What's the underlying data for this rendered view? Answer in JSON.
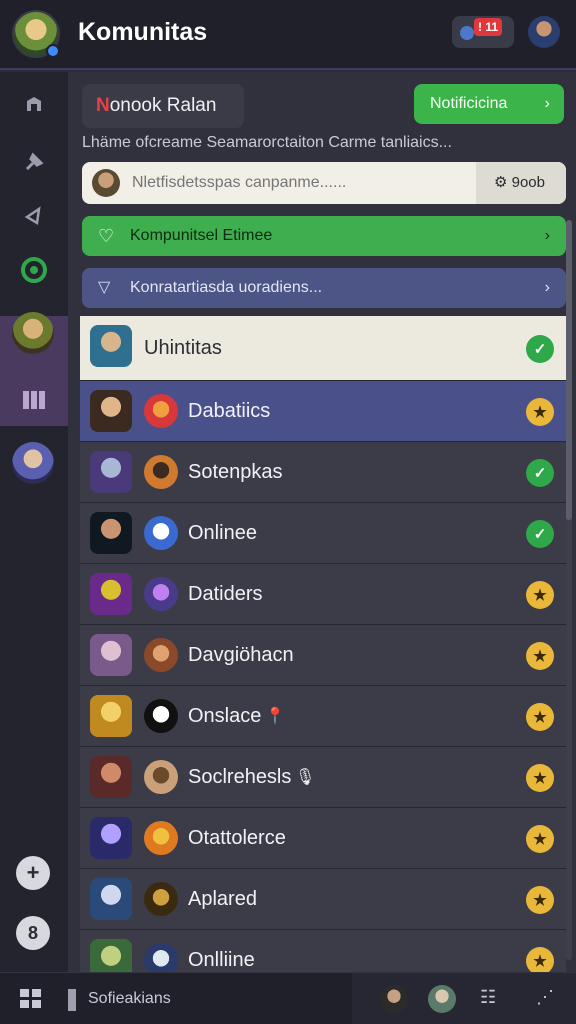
{
  "header": {
    "title": "Komunitas",
    "notif_count": "11",
    "notif_mark": "!"
  },
  "rail": {
    "icons": [
      "home-icon",
      "pin-icon",
      "megaphone-icon",
      "status-ring-icon",
      "library-icon",
      "plus-icon",
      "settings-icon"
    ]
  },
  "toolbar": {
    "left_pill_mark": "N",
    "left_pill_text": "onook Ralan",
    "right_pill_label": "Notificicina",
    "right_chev": "›"
  },
  "subtitle": "Lhäme ofcreame Seamarorctaiton Carme tanliaics...",
  "search": {
    "placeholder": "Nletfisdetsspas canpanme......",
    "right_label": "9oob"
  },
  "green_bar": {
    "label": "Kompunitsel Etimee",
    "chev": "›"
  },
  "blue_bar": {
    "label": "Konratartiasda uoradiens...",
    "chev": "›"
  },
  "list": [
    {
      "name": "Uhintitas",
      "status": "ok",
      "variant": "light"
    },
    {
      "name": "Dabatiics",
      "status": "star",
      "variant": "active"
    },
    {
      "name": "Sotenpkas",
      "status": "ok",
      "variant": "default"
    },
    {
      "name": "Onlinee",
      "status": "ok",
      "variant": "default"
    },
    {
      "name": "Datiders",
      "status": "star",
      "variant": "default"
    },
    {
      "name": "Davgiöhacn",
      "status": "star",
      "variant": "default"
    },
    {
      "name": "Onslace",
      "status": "star",
      "variant": "default",
      "suffix": "📍"
    },
    {
      "name": "Soclrehesls",
      "status": "star",
      "variant": "default",
      "suffix": "🎙"
    },
    {
      "name": "Otattolerce",
      "status": "star",
      "variant": "default"
    },
    {
      "name": "Aplared",
      "status": "star",
      "variant": "default"
    },
    {
      "name": "Onlliine",
      "status": "star",
      "variant": "default"
    }
  ],
  "status_glyphs": {
    "ok": "✓",
    "star": "★"
  },
  "bottom": {
    "label": "Sofieakians",
    "icons": [
      "grid-icon",
      "avatar",
      "avatar",
      "list-icon",
      "more-icon"
    ]
  },
  "colors": {
    "accent_green": "#3fae4e",
    "accent_blue": "#4c5585",
    "status_ok": "#2fa84a",
    "status_star": "#e9b73a",
    "alert_red": "#e0383d"
  }
}
